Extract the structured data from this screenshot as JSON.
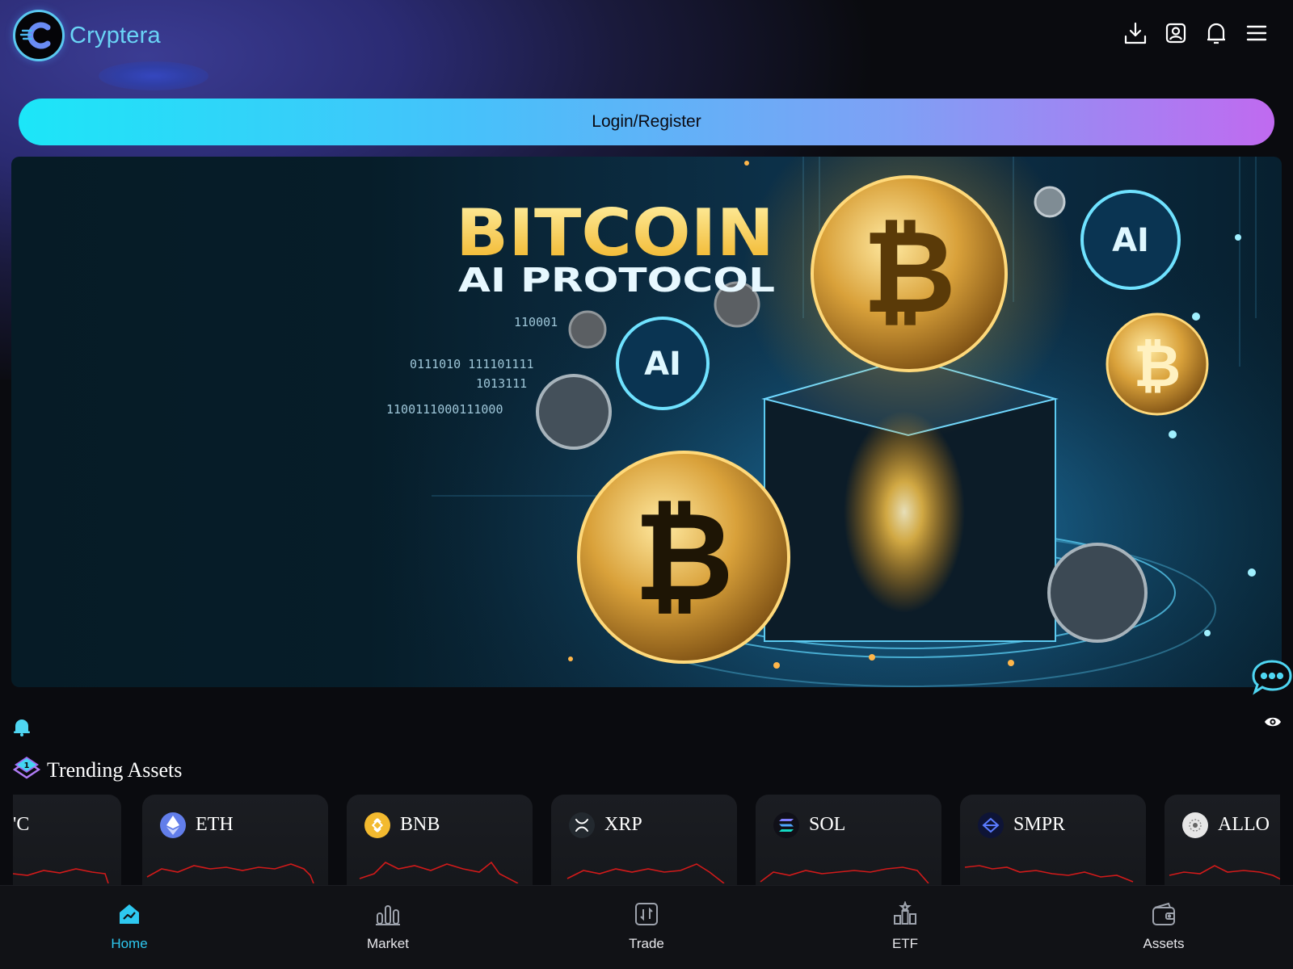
{
  "app": {
    "name": "Cryptera"
  },
  "header": {
    "icons": [
      "download-icon",
      "profile-icon",
      "bell-icon",
      "menu-icon"
    ]
  },
  "login": {
    "label": "Login/Register"
  },
  "banner": {
    "headline": "BITCOIN",
    "subheadline": "AI PROTOCOL",
    "badge": "AI"
  },
  "trending": {
    "title": "Trending Assets",
    "assets": [
      {
        "symbol": "BTC",
        "visible": "'C",
        "color": "#f7931a"
      },
      {
        "symbol": "ETH",
        "color": "#627eea"
      },
      {
        "symbol": "BNB",
        "color": "#f3ba2f"
      },
      {
        "symbol": "XRP",
        "color": "#23292f"
      },
      {
        "symbol": "SOL",
        "color": "#14f195"
      },
      {
        "symbol": "SMPR",
        "color": "#1b2a6b"
      },
      {
        "symbol": "ALLO",
        "color": "#e6e6e6"
      }
    ]
  },
  "nav": {
    "items": [
      {
        "label": "Home",
        "icon": "home-icon",
        "active": true
      },
      {
        "label": "Market",
        "icon": "market-icon",
        "active": false
      },
      {
        "label": "Trade",
        "icon": "trade-icon",
        "active": false
      },
      {
        "label": "ETF",
        "icon": "etf-icon",
        "active": false
      },
      {
        "label": "Assets",
        "icon": "wallet-icon",
        "active": false
      }
    ]
  },
  "colors": {
    "accent": "#2ec8f0",
    "spark": "#d11a1a",
    "brand": "#6ad4f6"
  }
}
